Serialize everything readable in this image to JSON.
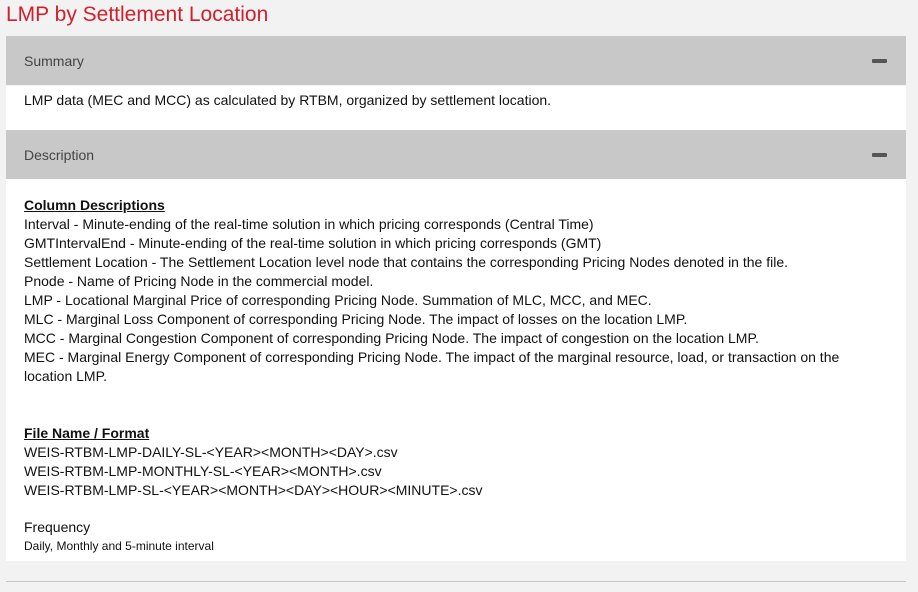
{
  "page": {
    "title": "LMP by Settlement Location",
    "title_color": "#d0202e"
  },
  "summary": {
    "header": "Summary",
    "icon": "minus-icon",
    "text": "LMP data (MEC and MCC) as calculated by RTBM, organized by settlement location."
  },
  "description": {
    "header": "Description",
    "icon": "minus-icon",
    "column_heading": "Column Descriptions",
    "columns": [
      "Interval - Minute-ending of the real-time solution in which pricing corresponds (Central Time)",
      "GMTIntervalEnd - Minute-ending of the real-time solution in which pricing corresponds (GMT)",
      "Settlement Location - The Settlement Location level node that contains the corresponding Pricing Nodes denoted in the file.",
      "Pnode - Name of Pricing Node in the commercial model.",
      "LMP - Locational Marginal Price of corresponding Pricing Node. Summation of MLC, MCC, and MEC.",
      "MLC - Marginal Loss Component of corresponding Pricing Node. The impact of losses on the location LMP.",
      "MCC - Marginal Congestion Component of corresponding Pricing Node. The impact of congestion on the location LMP.",
      "MEC - Marginal Energy Component of corresponding Pricing Node. The impact of the marginal resource, load, or transaction on the location LMP."
    ],
    "file_heading": "File Name / Format",
    "files": [
      "WEIS-RTBM-LMP-DAILY-SL-<YEAR><MONTH><DAY>.csv",
      "WEIS-RTBM-LMP-MONTHLY-SL-<YEAR><MONTH>.csv",
      "WEIS-RTBM-LMP-SL-<YEAR><MONTH><DAY><HOUR><MINUTE>.csv"
    ],
    "frequency_label": "Frequency",
    "frequency_value": "Daily, Monthly and 5-minute interval"
  }
}
